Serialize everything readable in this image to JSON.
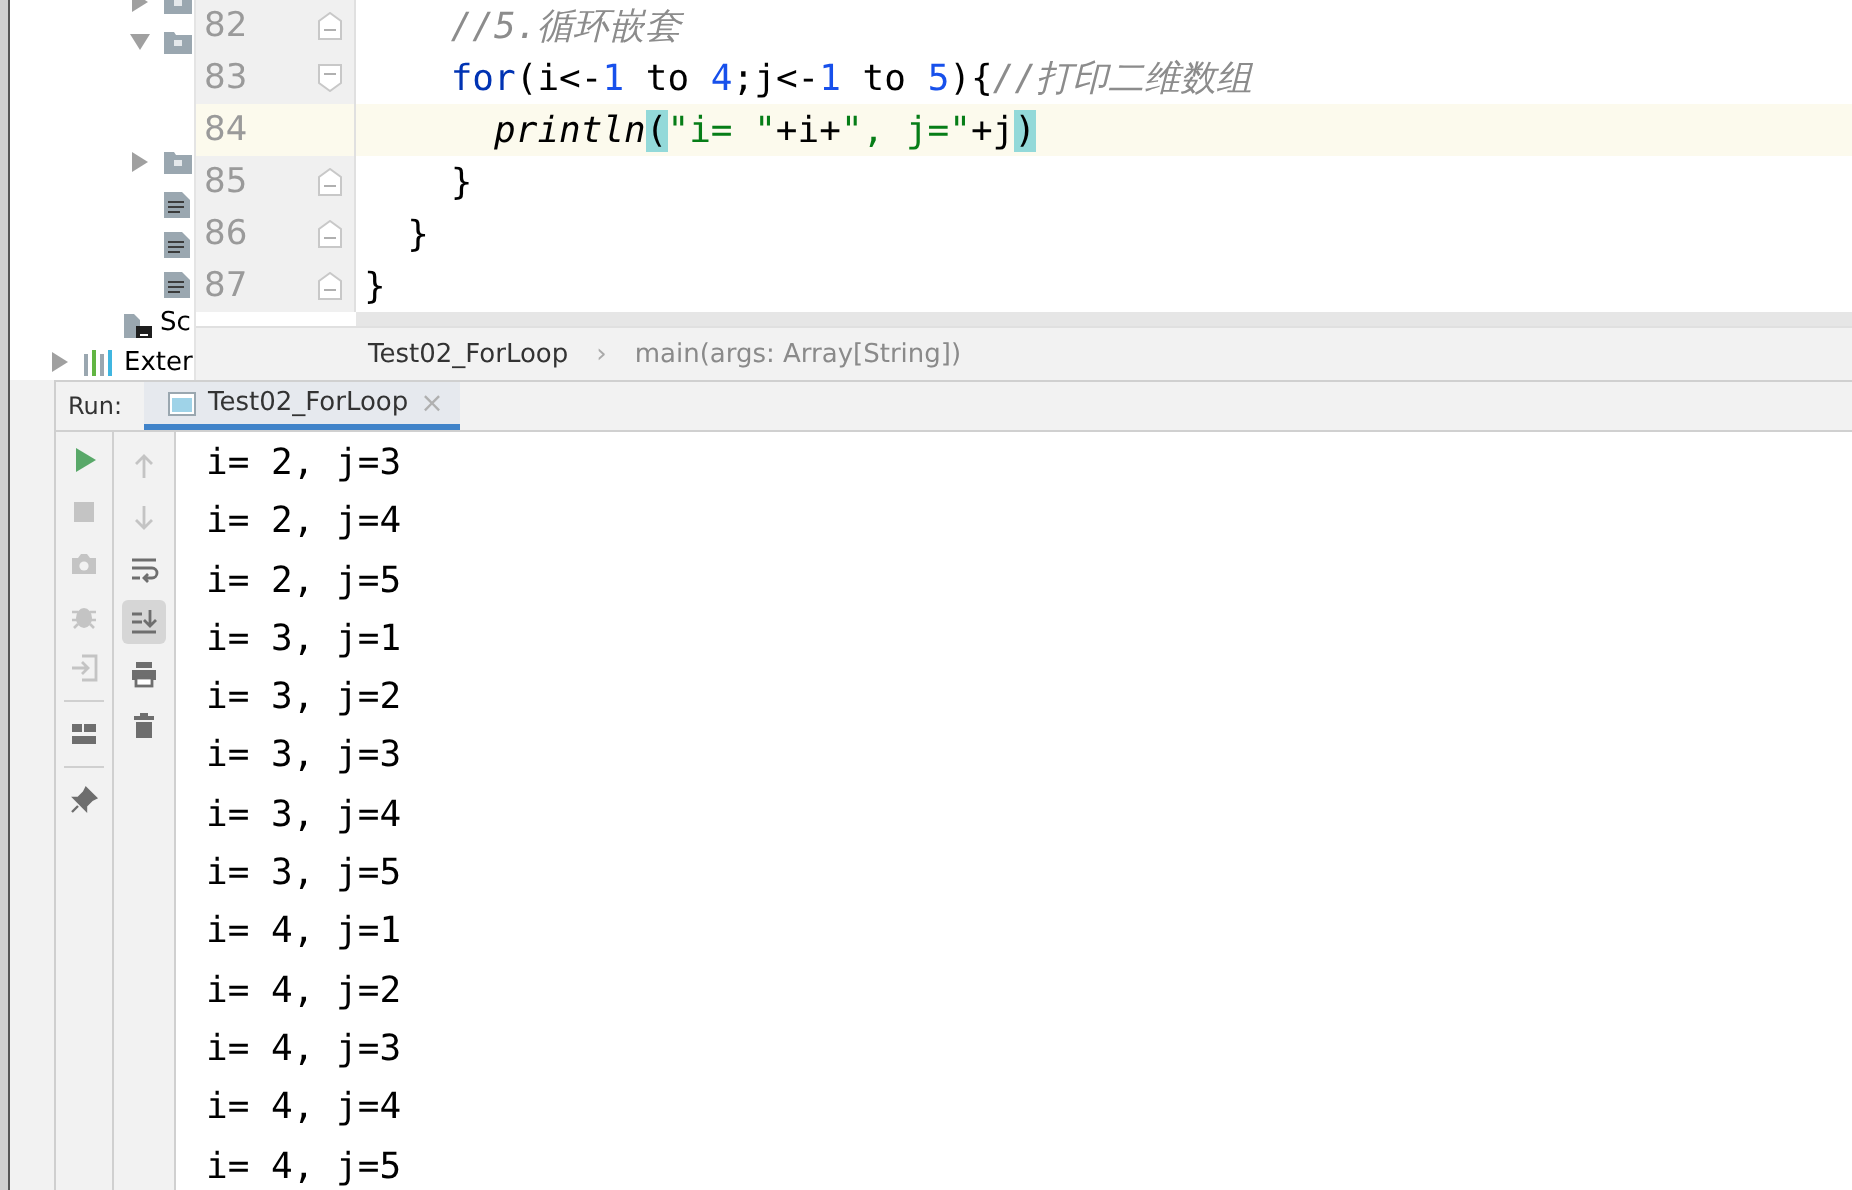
{
  "project_tree": {
    "items": [
      {
        "kind": "folder",
        "expanded": false
      },
      {
        "kind": "folder",
        "expanded": true
      },
      {
        "kind": "folder",
        "expanded": false
      },
      {
        "kind": "file"
      },
      {
        "kind": "file"
      },
      {
        "kind": "file"
      },
      {
        "kind": "scratch",
        "label": "Sc"
      },
      {
        "kind": "library",
        "expanded": false,
        "label": "Exter"
      }
    ]
  },
  "editor": {
    "lines": [
      {
        "number": "82",
        "fold_marker": true,
        "fold_open": false,
        "current": false,
        "tokens": [
          {
            "kind": "comment",
            "text": "    //5.循环嵌套"
          }
        ]
      },
      {
        "number": "83",
        "fold_marker": true,
        "fold_open": true,
        "current": false,
        "tokens": [
          {
            "kind": "keyword",
            "text": "    for"
          },
          {
            "kind": "plain",
            "text": "(i<-"
          },
          {
            "kind": "number",
            "text": "1"
          },
          {
            "kind": "plain",
            "text": " to "
          },
          {
            "kind": "number",
            "text": "4"
          },
          {
            "kind": "plain",
            "text": ";j<-"
          },
          {
            "kind": "number",
            "text": "1"
          },
          {
            "kind": "plain",
            "text": " to "
          },
          {
            "kind": "number",
            "text": "5"
          },
          {
            "kind": "plain",
            "text": "){"
          },
          {
            "kind": "comment",
            "text": "//打印二维数组"
          }
        ]
      },
      {
        "number": "84",
        "fold_marker": false,
        "current": true,
        "tokens": [
          {
            "kind": "function",
            "text": "      println"
          },
          {
            "kind": "match",
            "text": "("
          },
          {
            "kind": "string",
            "text": "\"i= \""
          },
          {
            "kind": "plain",
            "text": "+i+"
          },
          {
            "kind": "string",
            "text": "\", j=\""
          },
          {
            "kind": "plain",
            "text": "+j"
          },
          {
            "kind": "match",
            "text": ")"
          }
        ]
      },
      {
        "number": "85",
        "fold_marker": true,
        "fold_open": false,
        "current": false,
        "tokens": [
          {
            "kind": "plain",
            "text": "    }"
          }
        ]
      },
      {
        "number": "86",
        "fold_marker": true,
        "fold_open": false,
        "current": false,
        "tokens": [
          {
            "kind": "plain",
            "text": "  }"
          }
        ]
      },
      {
        "number": "87",
        "fold_marker": true,
        "fold_open": false,
        "current": false,
        "tokens": [
          {
            "kind": "plain",
            "text": "}"
          }
        ]
      }
    ]
  },
  "breadcrumb": {
    "items": [
      "Test02_ForLoop",
      "main(args: Array[String])"
    ],
    "separator": "›"
  },
  "run_panel": {
    "label": "Run:",
    "tab": {
      "title": "Test02_ForLoop",
      "close": "×",
      "selected": true
    },
    "left_toolbar": {
      "groups": [
        [
          {
            "kind": "run",
            "disabled": false
          },
          {
            "kind": "stop",
            "disabled": true
          },
          {
            "kind": "camera",
            "disabled": true
          },
          {
            "kind": "debug",
            "disabled": true
          },
          {
            "kind": "exit",
            "disabled": true
          }
        ],
        [
          {
            "kind": "layout",
            "disabled": false
          }
        ],
        [
          {
            "kind": "pin",
            "disabled": false
          }
        ]
      ]
    },
    "right_toolbar": [
      {
        "kind": "up",
        "disabled": true,
        "on": false
      },
      {
        "kind": "down",
        "disabled": true,
        "on": false
      },
      {
        "kind": "wrap",
        "disabled": false,
        "on": false
      },
      {
        "kind": "scroll-end",
        "disabled": false,
        "on": true
      },
      {
        "kind": "print",
        "disabled": false,
        "on": false
      },
      {
        "kind": "trash",
        "disabled": false,
        "on": false
      }
    ],
    "output": [
      "i= 2, j=3",
      "i= 2, j=4",
      "i= 2, j=5",
      "i= 3, j=1",
      "i= 3, j=2",
      "i= 3, j=3",
      "i= 3, j=4",
      "i= 3, j=5",
      "i= 4, j=1",
      "i= 4, j=2",
      "i= 4, j=3",
      "i= 4, j=4",
      "i= 4, j=5"
    ]
  }
}
